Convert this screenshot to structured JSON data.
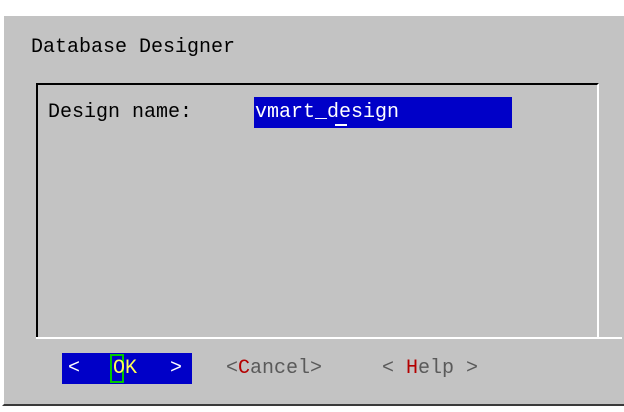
{
  "dialog": {
    "title": "Database Designer"
  },
  "form": {
    "field_label": "Design name:",
    "field_value": "vmart_design"
  },
  "buttons": {
    "ok": {
      "bracket_left": "<",
      "label": "OK",
      "bracket_right": ">"
    },
    "cancel": {
      "bracket_left": "<",
      "hotkey": "C",
      "rest": "ancel",
      "bracket_right": ">"
    },
    "help": {
      "bracket_left": "< ",
      "hotkey": "H",
      "rest": "elp",
      "bracket_right": " >"
    }
  },
  "colors": {
    "background": "#c3c3c3",
    "selection": "#0000c8",
    "hotkey": "#b40000",
    "focus_frame": "#00c800",
    "ok_text": "#ffff55",
    "inactive_text": "#5a5a5a"
  }
}
